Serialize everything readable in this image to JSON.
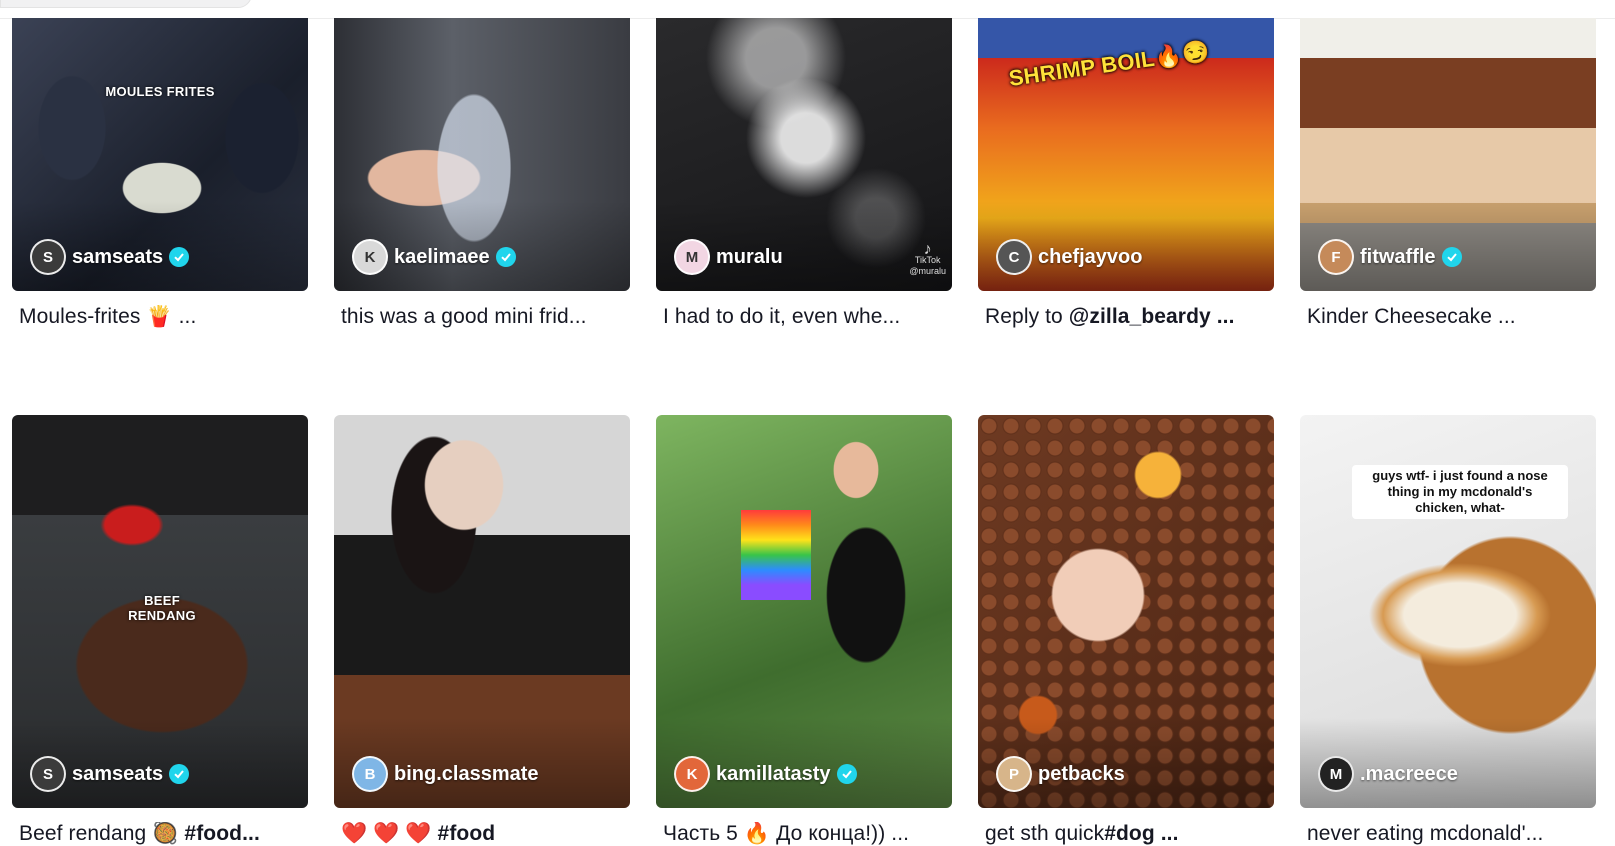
{
  "feed": {
    "videos": [
      {
        "username": "samseats",
        "verified": true,
        "description": "Moules-frites 🍟 ...",
        "desc_bold": "",
        "overlay": "MOULES FRITES",
        "avatar_glyph": "S"
      },
      {
        "username": "kaelimaee",
        "verified": true,
        "description": "this was a good mini frid...",
        "desc_bold": "",
        "overlay": "",
        "avatar_glyph": "K"
      },
      {
        "username": "muralu",
        "verified": false,
        "description": "I had to do it, even whe...",
        "desc_bold": "",
        "overlay": "",
        "avatar_glyph": "M",
        "watermark": "TikTok",
        "watermark_handle": "@muralu"
      },
      {
        "username": "chefjayvoo",
        "verified": false,
        "description": "Reply to ",
        "desc_bold": "@zilla_beardy ...",
        "overlay": "SHRIMP BOIL🔥😏",
        "avatar_glyph": "C"
      },
      {
        "username": "fitwaffle",
        "verified": true,
        "description": "Kinder Cheesecake ...",
        "desc_bold": "",
        "overlay": "",
        "avatar_glyph": "F"
      },
      {
        "username": "samseats",
        "verified": true,
        "description": "Beef rendang 🥘 ",
        "desc_bold": "#food...",
        "overlay": "BEEF RENDANG",
        "avatar_glyph": "S"
      },
      {
        "username": "bing.classmate",
        "verified": false,
        "description": "❤️ ❤️ ❤️ ",
        "desc_bold": "#food",
        "overlay": "",
        "avatar_glyph": "B"
      },
      {
        "username": "kamillatasty",
        "verified": true,
        "description": "Часть 5 🔥 До конца!)) ...",
        "desc_bold": "",
        "overlay": "",
        "avatar_glyph": "K"
      },
      {
        "username": "petbacks",
        "verified": false,
        "description": "get sth quick",
        "desc_bold": "#dog ...",
        "overlay": "",
        "avatar_glyph": "P"
      },
      {
        "username": ".macreece",
        "verified": false,
        "description": "never eating mcdonald'...",
        "desc_bold": "",
        "overlay": "guys wtf- i just found a nose thing in my mcdonald's chicken, what-",
        "avatar_glyph": "M"
      }
    ]
  },
  "colors": {
    "verified_badge": "#20d5ec",
    "text_primary": "#161823"
  },
  "icons": {
    "verified": "verified-check-icon",
    "watermark": "tiktok-note-icon"
  }
}
